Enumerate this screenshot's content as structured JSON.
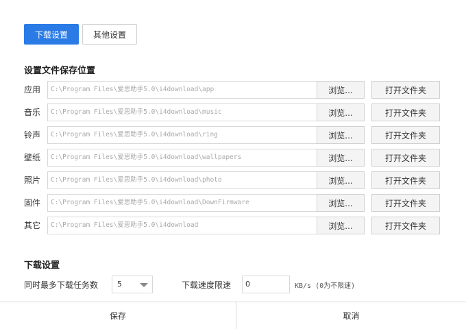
{
  "tabs": [
    {
      "label": "下载设置",
      "active": true
    },
    {
      "label": "其他设置",
      "active": false
    }
  ],
  "save_location": {
    "title": "设置文件保存位置",
    "browse_label": "浏览...",
    "open_folder_label": "打开文件夹",
    "rows": [
      {
        "label": "应用",
        "path": "C:\\Program Files\\爱思助手5.0\\i4download\\app"
      },
      {
        "label": "音乐",
        "path": "C:\\Program Files\\爱思助手5.0\\i4download\\music"
      },
      {
        "label": "铃声",
        "path": "C:\\Program Files\\爱思助手5.0\\i4download\\ring"
      },
      {
        "label": "壁纸",
        "path": "C:\\Program Files\\爱思助手5.0\\i4download\\wallpapers"
      },
      {
        "label": "照片",
        "path": "C:\\Program Files\\爱思助手5.0\\i4download\\photo"
      },
      {
        "label": "固件",
        "path": "C:\\Program Files\\爱思助手5.0\\i4download\\DownFirmware"
      },
      {
        "label": "其它",
        "path": "C:\\Program Files\\爱思助手5.0\\i4download"
      }
    ]
  },
  "download_settings": {
    "title": "下载设置",
    "max_tasks_label": "同时最多下载任务数",
    "max_tasks_value": "5",
    "speed_limit_label": "下载速度限速",
    "speed_limit_value": "0",
    "speed_unit_hint": "KB/s (0为不限速)"
  },
  "footer": {
    "save_label": "保存",
    "cancel_label": "取消"
  },
  "colors": {
    "accent": "#2a7be6",
    "border": "#d8d8d8",
    "placeholder_text": "#aaaaaa"
  }
}
